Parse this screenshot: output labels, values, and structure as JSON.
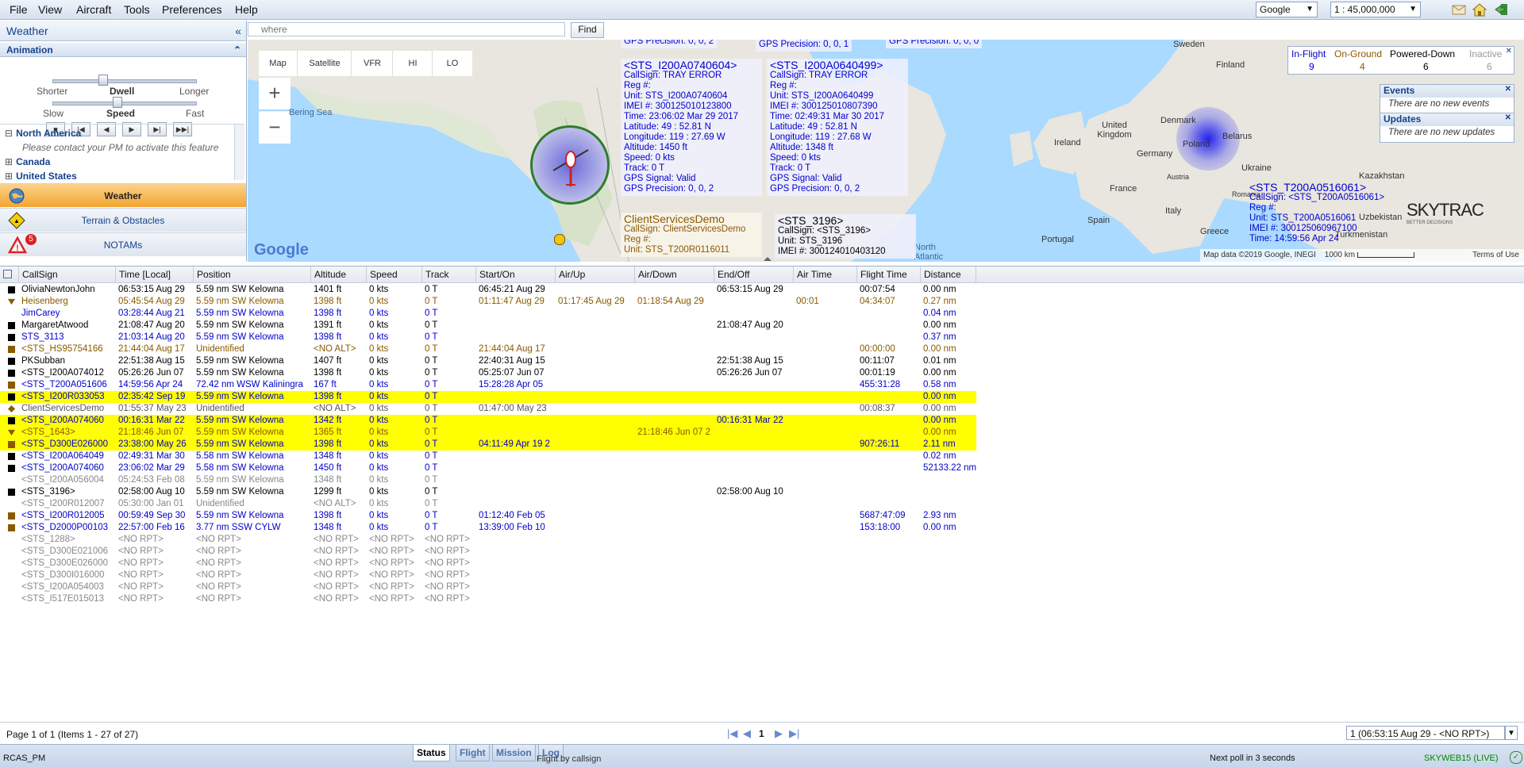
{
  "menu": {
    "items": [
      "File",
      "View",
      "Aircraft",
      "Tools",
      "Preferences",
      "Help"
    ]
  },
  "toolbar": {
    "map_provider": "Google",
    "scale": "1 : 45,000,000"
  },
  "search": {
    "placeholder": "where",
    "find_label": "Find"
  },
  "left_panel": {
    "title": "Weather",
    "animation": {
      "label": "Animation",
      "dwell": {
        "shorter": "Shorter",
        "label": "Dwell",
        "longer": "Longer",
        "level": 0.35
      },
      "speed": {
        "slow": "Slow",
        "label": "Speed",
        "fast": "Fast",
        "level": 0.45
      }
    },
    "tree": {
      "north_america": "North America",
      "contact_msg": "Please contact your PM to activate this feature",
      "canada": "Canada",
      "united_states": "United States"
    },
    "layers": [
      {
        "label": "Weather",
        "active": true
      },
      {
        "label": "Terrain & Obstacles",
        "active": false
      },
      {
        "label": "NOTAMs",
        "active": false,
        "badge": "5"
      }
    ]
  },
  "map": {
    "types": [
      "Map",
      "Satellite",
      "VFR",
      "HI",
      "LO"
    ],
    "zoom_in": "+",
    "zoom_out": "−",
    "labels": {
      "bering_sea": "Bering Sea",
      "sweden": "Sweden",
      "finland": "Finland",
      "denmark": "Denmark",
      "united_kingdom": "United Kingdom",
      "ireland": "Ireland",
      "poland": "Poland",
      "belarus": "Belarus",
      "germany": "Germany",
      "france": "France",
      "austria": "Austria",
      "ukraine": "Ukraine",
      "italy": "Italy",
      "spain": "Spain",
      "portugal": "Portugal",
      "greece": "Greece",
      "kazakhstan": "Kazakhstan",
      "uzbekistan": "Uzbekistan",
      "turkmenistan": "Turkmenistan",
      "romania": "Romania",
      "north_atlantic": "North\nAtlantic"
    },
    "google_logo": "Google",
    "attribution": "Map data ©2019 Google, INEGI",
    "scale_text": "1000 km",
    "terms": "Terms of Use",
    "popups": [
      {
        "head": "GPS Precision: 0, 0, 2",
        "title": "",
        "lines": []
      },
      {
        "head": "GPS Precision: 0, 0, 1",
        "title": "",
        "lines": []
      },
      {
        "head": "GPS Precision: 0, 0, 0",
        "title": "",
        "lines": []
      },
      {
        "title": "<STS_I200A0740604>",
        "lines": [
          "CallSign: TRAY ERROR",
          "Reg #:",
          "Unit: STS_I200A0740604",
          "IMEI #: 300125010123800",
          "Time: 23:06:02 Mar 29 2017",
          "Latitude: 49 : 52.81 N",
          "Longitude: 119 : 27.69 W",
          "Altitude: 1450 ft",
          "Speed: 0 kts",
          "Track: 0 T",
          "GPS Signal: Valid",
          "GPS Precision: 0, 0, 2"
        ]
      },
      {
        "title": "<STS_I200A0640499>",
        "lines": [
          "CallSign: TRAY ERROR",
          "Reg #:",
          "Unit: STS_I200A0640499",
          "IMEI #: 300125010807390",
          "Time: 02:49:31 Mar 30 2017",
          "Latitude: 49 : 52.81 N",
          "Longitude: 119 : 27.68 W",
          "Altitude: 1348 ft",
          "Speed: 0 kts",
          "Track: 0 T",
          "GPS Signal: Valid",
          "GPS Precision: 0, 0, 2"
        ]
      },
      {
        "title": "ClientServicesDemo",
        "lines": [
          "CallSign: ClientServicesDemo",
          "Reg #:",
          "Unit: STS_T200R0116011"
        ]
      },
      {
        "title": "<STS_3196>",
        "lines": [
          "CallSign: <STS_3196>",
          "Unit: STS_3196",
          "IMEI #: 300124010403120"
        ]
      },
      {
        "title": "<STS_T200A0516061>",
        "lines": [
          "CallSign: <STS_T200A0516061>",
          "Reg #:",
          "Unit: STS_T200A0516061",
          "IMEI #: 300125060967100",
          "Time: 14:59:56 Apr 24"
        ]
      }
    ],
    "brand": "SKYTRAC",
    "brand_tag": "BETTER DECISIONS"
  },
  "counts": {
    "headers": [
      "In-Flight",
      "On-Ground",
      "Powered-Down",
      "Inactive"
    ],
    "values": [
      "9",
      "4",
      "6",
      "6"
    ]
  },
  "events": {
    "title": "Events",
    "msg": "There are no new events"
  },
  "updates": {
    "title": "Updates",
    "msg": "There are no new updates"
  },
  "grid": {
    "columns": [
      "CallSign",
      "Time [Local]",
      "Position",
      "Altitude",
      "Speed",
      "Track",
      "Start/On",
      "Air/Up",
      "Air/Down",
      "End/Off",
      "Air Time",
      "Flight Time",
      "Distance"
    ],
    "rows": [
      {
        "icon": "black",
        "color": "#000000",
        "hl": false,
        "cells": [
          "OliviaNewtonJohn",
          "06:53:15 Aug 29",
          "5.59 nm SW Kelowna",
          "1401 ft",
          "0 kts",
          "0 T",
          "06:45:21 Aug 29",
          "",
          "",
          "06:53:15 Aug 29",
          "",
          "00:07:54",
          "0.00 nm"
        ]
      },
      {
        "icon": "tri",
        "color": "#8a5a00",
        "hl": false,
        "cells": [
          "Heisenberg",
          "05:45:54 Aug 29",
          "5.59 nm SW Kelowna",
          "1398 ft",
          "0 kts",
          "0 T",
          "01:11:47 Aug 29",
          "01:17:45 Aug 29",
          "01:18:54 Aug 29",
          "",
          "00:01",
          "04:34:07",
          "0.27 nm"
        ]
      },
      {
        "icon": "none",
        "color": "#0000cc",
        "hl": false,
        "cells": [
          "JimCarey",
          "03:28:44 Aug 21",
          "5.59 nm SW Kelowna",
          "1398 ft",
          "0 kts",
          "0 T",
          "",
          "",
          "",
          "",
          "",
          "",
          "0.04 nm"
        ]
      },
      {
        "icon": "black",
        "color": "#000000",
        "hl": false,
        "cells": [
          "MargaretAtwood",
          "21:08:47 Aug 20",
          "5.59 nm SW Kelowna",
          "1391 ft",
          "0 kts",
          "0 T",
          "",
          "",
          "",
          "21:08:47 Aug 20",
          "",
          "",
          "0.00 nm"
        ]
      },
      {
        "icon": "black",
        "color": "#0000cc",
        "hl": false,
        "cells": [
          "STS_3113",
          "21:03:14 Aug 20",
          "5.59 nm SW Kelowna",
          "1398 ft",
          "0 kts",
          "0 T",
          "",
          "",
          "",
          "",
          "",
          "",
          "0.37 nm"
        ]
      },
      {
        "icon": "brown",
        "color": "#8a5a00",
        "hl": false,
        "cells": [
          "<STS_HS95754166",
          "21:44:04 Aug 17",
          "Unidentified",
          "<NO ALT>",
          "0 kts",
          "0 T",
          "21:44:04 Aug 17",
          "",
          "",
          "",
          "",
          "00:00:00",
          "0.00 nm"
        ]
      },
      {
        "icon": "black",
        "color": "#000000",
        "hl": false,
        "cells": [
          "PKSubban",
          "22:51:38 Aug 15",
          "5.59 nm SW Kelowna",
          "1407 ft",
          "0 kts",
          "0 T",
          "22:40:31 Aug 15",
          "",
          "",
          "22:51:38 Aug 15",
          "",
          "00:11:07",
          "0.01 nm"
        ]
      },
      {
        "icon": "black",
        "color": "#000000",
        "hl": false,
        "cells": [
          "<STS_I200A074012",
          "05:26:26 Jun 07",
          "5.59 nm SW Kelowna",
          "1398 ft",
          "0 kts",
          "0 T",
          "05:25:07 Jun 07",
          "",
          "",
          "05:26:26 Jun 07",
          "",
          "00:01:19",
          "0.00 nm"
        ]
      },
      {
        "icon": "brown",
        "color": "#0000cc",
        "hl": false,
        "cells": [
          "<STS_T200A051606",
          "14:59:56 Apr 24",
          "72.42 nm WSW Kaliningra",
          "167 ft",
          "0 kts",
          "0 T",
          "15:28:28 Apr 05",
          "",
          "",
          "",
          "",
          "455:31:28",
          "0.58 nm"
        ]
      },
      {
        "icon": "black",
        "color": "#0000cc",
        "hl": true,
        "cells": [
          "<STS_I200R033053",
          "02:35:42 Sep 19",
          "5.59 nm SW Kelowna",
          "1398 ft",
          "0 kts",
          "0 T",
          "",
          "",
          "",
          "",
          "",
          "",
          "0.00 nm"
        ]
      },
      {
        "icon": "diamond",
        "color": "#555555",
        "hl": false,
        "cells": [
          "ClientServicesDemo",
          "01:55:37 May 23",
          "Unidentified",
          "<NO ALT>",
          "0 kts",
          "0 T",
          "01:47:00 May 23",
          "",
          "",
          "",
          "",
          "00:08:37",
          "0.00 nm"
        ]
      },
      {
        "icon": "black",
        "color": "#0000cc",
        "hl": true,
        "cells": [
          "<STS_I200A074060",
          "00:16:31 Mar 22",
          "5.59 nm SW Kelowna",
          "1342 ft",
          "0 kts",
          "0 T",
          "",
          "",
          "",
          "00:16:31 Mar 22",
          "",
          "",
          "0.00 nm"
        ]
      },
      {
        "icon": "tri",
        "color": "#8a5a00",
        "hl": true,
        "cells": [
          "<STS_1643>",
          "21:18:46 Jun 07",
          "5.59 nm SW Kelowna",
          "1365 ft",
          "0 kts",
          "0 T",
          "",
          "",
          "21:18:46 Jun 07 2",
          "",
          "",
          "",
          "0.00 nm"
        ]
      },
      {
        "icon": "brown",
        "color": "#0000cc",
        "hl": true,
        "cells": [
          "<STS_D300E026000",
          "23:38:00 May 26",
          "5.59 nm SW Kelowna",
          "1398 ft",
          "0 kts",
          "0 T",
          "04:11:49 Apr 19 2",
          "",
          "",
          "",
          "",
          "907:26:11",
          "2.11 nm"
        ]
      },
      {
        "icon": "black",
        "color": "#0000cc",
        "hl": false,
        "cells": [
          "<STS_I200A064049",
          "02:49:31 Mar 30",
          "5.58 nm SW Kelowna",
          "1348 ft",
          "0 kts",
          "0 T",
          "",
          "",
          "",
          "",
          "",
          "",
          "0.02 nm"
        ]
      },
      {
        "icon": "black",
        "color": "#0000cc",
        "hl": false,
        "cells": [
          "<STS_I200A074060",
          "23:06:02 Mar 29",
          "5.58 nm SW Kelowna",
          "1450 ft",
          "0 kts",
          "0 T",
          "",
          "",
          "",
          "",
          "",
          "",
          "52133.22 nm"
        ]
      },
      {
        "icon": "none",
        "color": "#888888",
        "hl": false,
        "cells": [
          "<STS_I200A056004",
          "05:24:53 Feb 08",
          "5.59 nm SW Kelowna",
          "1348 ft",
          "0 kts",
          "0 T",
          "",
          "",
          "",
          "",
          "",
          "",
          ""
        ]
      },
      {
        "icon": "black",
        "color": "#000000",
        "hl": false,
        "cells": [
          "<STS_3196>",
          "02:58:00 Aug 10",
          "5.59 nm SW Kelowna",
          "1299 ft",
          "0 kts",
          "0 T",
          "",
          "",
          "",
          "02:58:00 Aug 10",
          "",
          "",
          ""
        ]
      },
      {
        "icon": "none",
        "color": "#888888",
        "hl": false,
        "cells": [
          "<STS_I200R012007",
          "05:30:00 Jan 01",
          "Unidentified",
          "<NO ALT>",
          "0 kts",
          "0 T",
          "",
          "",
          "",
          "",
          "",
          "",
          ""
        ]
      },
      {
        "icon": "brown",
        "color": "#0000cc",
        "hl": false,
        "cells": [
          "<STS_I200R012005",
          "00:59:49 Sep 30",
          "5.59 nm SW Kelowna",
          "1398 ft",
          "0 kts",
          "0 T",
          "01:12:40 Feb 05",
          "",
          "",
          "",
          "",
          "5687:47:09",
          "2.93 nm"
        ]
      },
      {
        "icon": "brown",
        "color": "#0000cc",
        "hl": false,
        "cells": [
          "<STS_D2000P00103",
          "22:57:00 Feb 16",
          "3.77 nm SSW CYLW",
          "1348 ft",
          "0 kts",
          "0 T",
          "13:39:00 Feb 10",
          "",
          "",
          "",
          "",
          "153:18:00",
          "0.00 nm"
        ]
      },
      {
        "icon": "none",
        "color": "#888888",
        "hl": false,
        "cells": [
          "<STS_1288>",
          "<NO RPT>",
          "<NO RPT>",
          "<NO RPT>",
          "<NO RPT>",
          "<NO RPT>",
          "",
          "",
          "",
          "",
          "",
          "",
          ""
        ]
      },
      {
        "icon": "none",
        "color": "#888888",
        "hl": false,
        "cells": [
          "<STS_D300E021006",
          "<NO RPT>",
          "<NO RPT>",
          "<NO RPT>",
          "<NO RPT>",
          "<NO RPT>",
          "",
          "",
          "",
          "",
          "",
          "",
          ""
        ]
      },
      {
        "icon": "none",
        "color": "#888888",
        "hl": false,
        "cells": [
          "<STS_D300E026000",
          "<NO RPT>",
          "<NO RPT>",
          "<NO RPT>",
          "<NO RPT>",
          "<NO RPT>",
          "",
          "",
          "",
          "",
          "",
          "",
          ""
        ]
      },
      {
        "icon": "none",
        "color": "#888888",
        "hl": false,
        "cells": [
          "<STS_D300I016000",
          "<NO RPT>",
          "<NO RPT>",
          "<NO RPT>",
          "<NO RPT>",
          "<NO RPT>",
          "",
          "",
          "",
          "",
          "",
          "",
          ""
        ]
      },
      {
        "icon": "none",
        "color": "#888888",
        "hl": false,
        "cells": [
          "<STS_I200A054003",
          "<NO RPT>",
          "<NO RPT>",
          "<NO RPT>",
          "<NO RPT>",
          "<NO RPT>",
          "",
          "",
          "",
          "",
          "",
          "",
          ""
        ]
      },
      {
        "icon": "none",
        "color": "#888888",
        "hl": false,
        "cells": [
          "<STS_I517E015013",
          "<NO RPT>",
          "<NO RPT>",
          "<NO RPT>",
          "<NO RPT>",
          "<NO RPT>",
          "",
          "",
          "",
          "",
          "",
          "",
          ""
        ]
      }
    ]
  },
  "pager": {
    "summary": "Page 1 of 1 (Items 1 - 27 of 27)",
    "page": "1",
    "selector": "1 (06:53:15 Aug 29 - <NO RPT>)"
  },
  "tabs": {
    "items": [
      "Status",
      "Flight",
      "Mission",
      "Log"
    ],
    "active": "Status"
  },
  "status": {
    "user": "RCAS_PM",
    "sort": "Flight by callsign",
    "poll": "Next poll in 3 seconds",
    "server": "SKYWEB15 (LIVE)"
  },
  "colors": {
    "highlight": "#ffff00",
    "accent": "#15428b",
    "layer_active": "#f7b84a",
    "live": "#008800"
  }
}
